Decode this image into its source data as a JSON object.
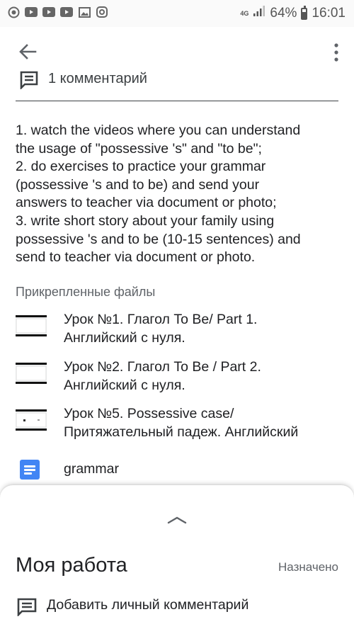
{
  "status_bar": {
    "icons": [
      "whatsapp-icon",
      "youtube-icon",
      "youtube-icon",
      "youtube-icon",
      "gallery-icon",
      "instagram-icon"
    ],
    "network": "4G",
    "battery": "64%",
    "time": "16:01"
  },
  "app_bar": {
    "back_icon": "arrow-back-icon",
    "menu_icon": "more-vert-icon"
  },
  "comments_peek": {
    "label": "1 комментарий"
  },
  "assignment": {
    "lines": [
      "1. watch the videos where you can understand",
      "the usage of \"possessive 's\" and \"to be\";",
      "2. do exercises to practice your grammar",
      "(possessive 's and to be) and send your",
      "answers to teacher via document or photo;",
      "3. write short story about your family using",
      "possessive 's and to be (10-15 sentences) and",
      "send to teacher via document or photo."
    ]
  },
  "attachments": {
    "heading": "Прикрепленные файлы",
    "items": [
      {
        "type": "video",
        "line1": "Урок №1. Глагол To Be/ Part 1.",
        "line2": "Английский с нуля."
      },
      {
        "type": "video",
        "line1": "Урок №2. Глагол To Be / Part 2.",
        "line2": "Английский с нуля."
      },
      {
        "type": "video",
        "line1": "Урок №5. Possessive case/",
        "line2": "Притяжательный падеж. Английский"
      },
      {
        "type": "document",
        "line1": "grammar",
        "line2": ""
      }
    ]
  },
  "my_work": {
    "title": "Моя работа",
    "status": "Назначено",
    "add_comment": "Добавить личный комментарий"
  },
  "colors": {
    "doc_blue": "#4285f4",
    "text": "#202124",
    "secondary_text": "#5f6368"
  }
}
